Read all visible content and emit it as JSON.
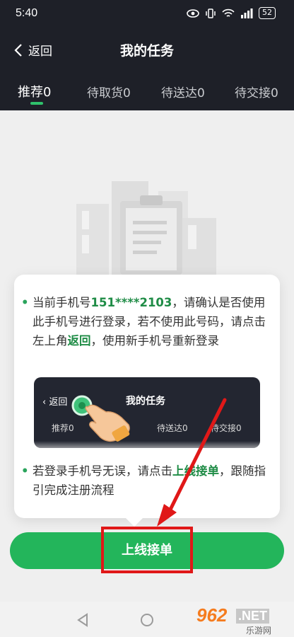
{
  "status": {
    "time": "5:40",
    "battery": "52"
  },
  "nav": {
    "back": "返回",
    "title": "我的任务"
  },
  "tabs": [
    {
      "label": "推荐0"
    },
    {
      "label": "待取货0"
    },
    {
      "label": "待送达0"
    },
    {
      "label": "待交接0"
    }
  ],
  "popup": {
    "p1_a": "当前手机号",
    "p1_phone": "151****2103",
    "p1_b": "，请确认是否使用此手机号进行登录，若不使用此号码，请点击左上角",
    "p1_link": "返回",
    "p1_c": "，使用新手机号重新登录",
    "mini": {
      "back": "返回",
      "title": "我的任务",
      "tab1": "推荐0",
      "tab2": "待送达0",
      "tab3": "待交接0"
    },
    "p2_a": "若登录手机号无误，请点击",
    "p2_link": "上线接单",
    "p2_b": "，跟随指引完成注册流程"
  },
  "cta": {
    "label": "上线接单"
  },
  "watermark": {
    "text_top": "962",
    "text_net": ".NET",
    "text_bottom": "乐游网"
  },
  "colors": {
    "accent": "#23b55b",
    "header": "#1e2028",
    "annotation": "#e01818"
  }
}
